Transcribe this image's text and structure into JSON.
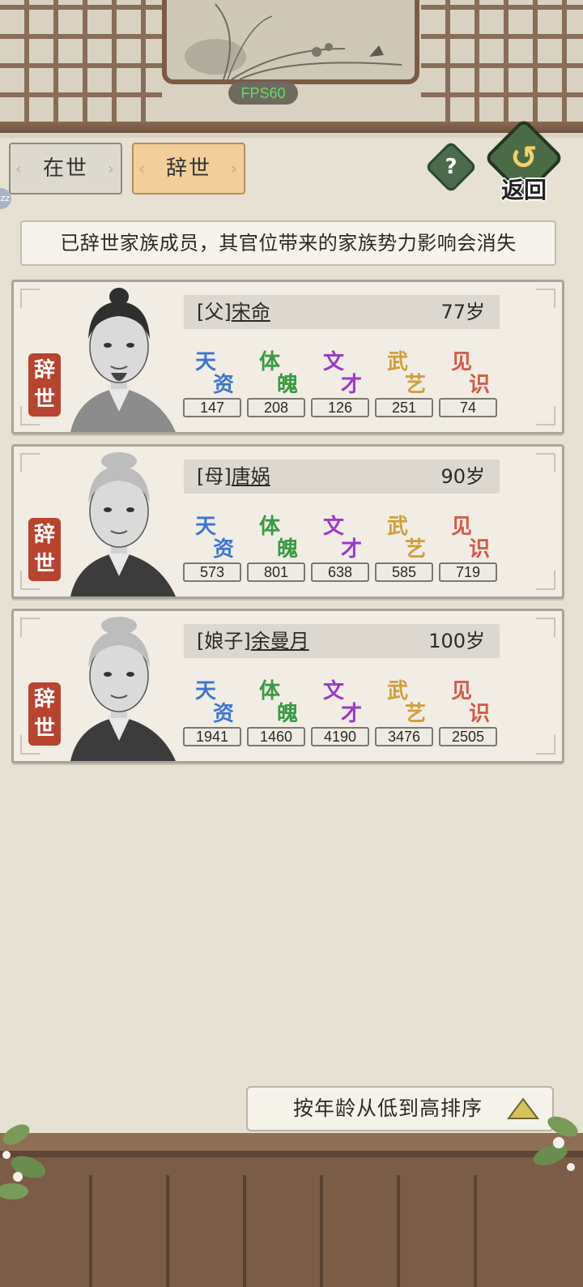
{
  "fps": "FPS60",
  "tabs": {
    "alive": "在世",
    "deceased": "辞世",
    "active": "deceased"
  },
  "help_label": "?",
  "back_label": "返回",
  "side_badge": "zz",
  "notice": "已辞世家族成员，其官位带来的家族势力影响会消失",
  "stat_names": [
    {
      "c1": "天",
      "c2": "资",
      "color": "#3f74d3"
    },
    {
      "c1": "体",
      "c2": "魄",
      "color": "#3a9a45"
    },
    {
      "c1": "文",
      "c2": "才",
      "color": "#9a3ac8"
    },
    {
      "c1": "武",
      "c2": "艺",
      "color": "#cfa03a"
    },
    {
      "c1": "见",
      "c2": "识",
      "color": "#d55a4a"
    }
  ],
  "members": [
    {
      "relation": "[父]",
      "name": "宋命",
      "age": "77岁",
      "status": "辞世",
      "stats": [
        "147",
        "208",
        "126",
        "251",
        "74"
      ],
      "gender": "male"
    },
    {
      "relation": "[母]",
      "name": "唐娲",
      "age": "90岁",
      "status": "辞世",
      "stats": [
        "573",
        "801",
        "638",
        "585",
        "719"
      ],
      "gender": "female"
    },
    {
      "relation": "[娘子]",
      "name": "余曼月",
      "age": "100岁",
      "status": "辞世",
      "stats": [
        "1941",
        "1460",
        "4190",
        "3476",
        "2505"
      ],
      "gender": "female"
    }
  ],
  "sort": {
    "label": "按年龄从低到高排序",
    "icon": "triangle-up-icon"
  }
}
